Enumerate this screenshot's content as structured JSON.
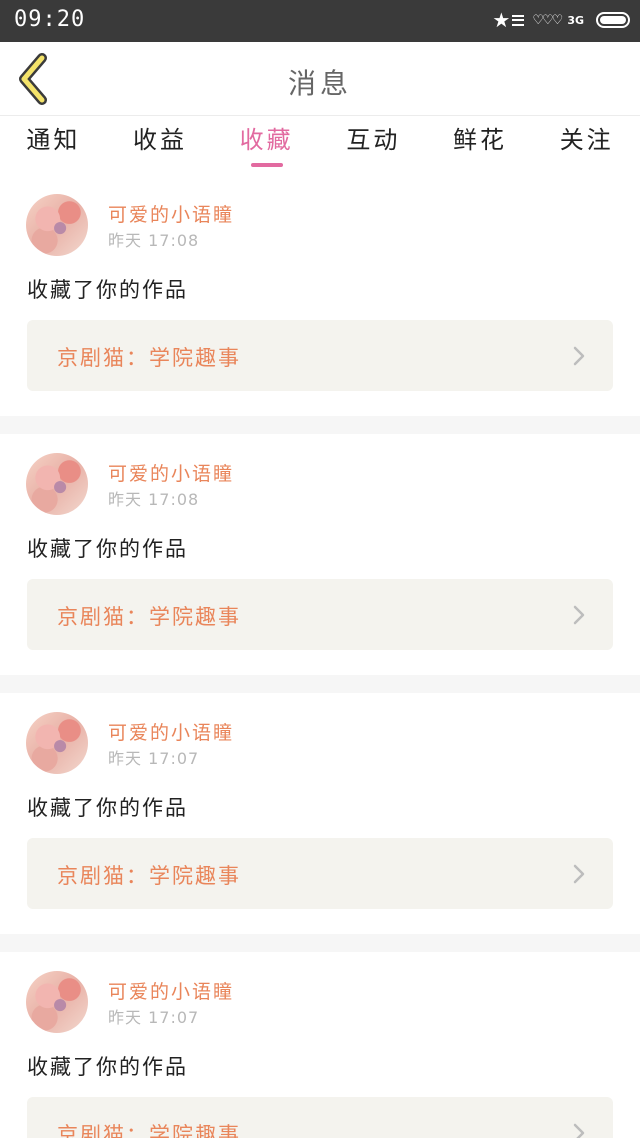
{
  "status_bar": {
    "time": "09:20",
    "network": "3G",
    "icons": [
      "star-icon",
      "menu-icon",
      "signal-icon",
      "battery-icon"
    ]
  },
  "header": {
    "title": "消息",
    "back_icon": "chevron-left-icon"
  },
  "tabs": [
    {
      "label": "通知",
      "active": false
    },
    {
      "label": "收益",
      "active": false
    },
    {
      "label": "收藏",
      "active": true
    },
    {
      "label": "互动",
      "active": false
    },
    {
      "label": "鲜花",
      "active": false
    },
    {
      "label": "关注",
      "active": false
    }
  ],
  "colors": {
    "accent": "#e26aa0",
    "username": "#e9855a",
    "work_box_bg": "#f4f3ee",
    "status_bar": "#3a3a3a"
  },
  "messages": [
    {
      "user": "可爱的小语瞳",
      "time": "昨天 17:08",
      "action": "收藏了你的作品",
      "work": "京剧猫：学院趣事"
    },
    {
      "user": "可爱的小语瞳",
      "time": "昨天 17:08",
      "action": "收藏了你的作品",
      "work": "京剧猫：学院趣事"
    },
    {
      "user": "可爱的小语瞳",
      "time": "昨天 17:07",
      "action": "收藏了你的作品",
      "work": "京剧猫：学院趣事"
    },
    {
      "user": "可爱的小语瞳",
      "time": "昨天 17:07",
      "action": "收藏了你的作品",
      "work": "京剧猫：学院趣事"
    }
  ]
}
